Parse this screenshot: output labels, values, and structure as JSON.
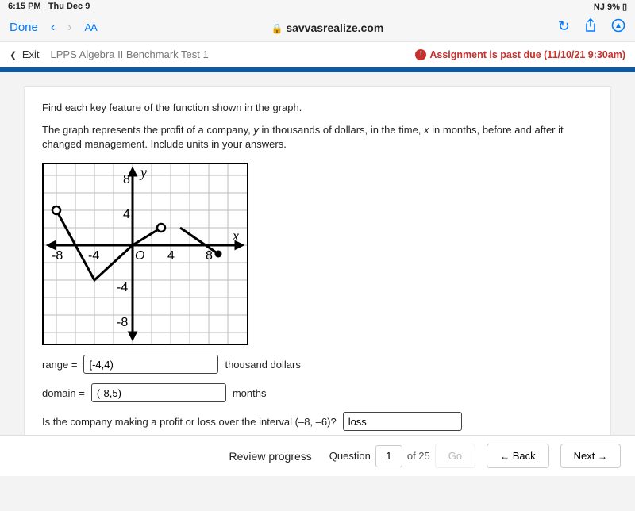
{
  "status": {
    "time": "6:15 PM",
    "date": "Thu Dec 9",
    "battery": "9%"
  },
  "browser": {
    "done": "Done",
    "aa": "AA",
    "url": "savvasrealize.com"
  },
  "header": {
    "exit": "Exit",
    "title": "LPPS Algebra II Benchmark Test 1",
    "past_due": "Assignment is past due (11/10/21 9:30am)"
  },
  "question": {
    "line1": "Find each key feature of the function shown in the graph.",
    "line2a": "The graph represents the profit of a company, ",
    "line2b": " in thousands of dollars, in the time, ",
    "line2c": " in months, before and after it changed management. Include units in your answers.",
    "var_y": "y",
    "var_x": "x",
    "range_label": "range =",
    "range_value": "[-4,4)",
    "range_unit": "thousand dollars",
    "domain_label": "domain =",
    "domain_value": "(-8,5)",
    "domain_unit": "months",
    "interval_q": "Is the company making a profit or loss over the interval (–8, –6)?",
    "interval_value": "loss"
  },
  "chart_data": {
    "type": "line",
    "xlabel": "x",
    "ylabel": "y",
    "xticks": [
      -8,
      -4,
      4,
      8
    ],
    "yticks": [
      -8,
      -4,
      4,
      8
    ],
    "xlim": [
      -10,
      10
    ],
    "ylim": [
      -10,
      10
    ],
    "series": [
      {
        "name": "profit",
        "points": [
          [
            -8,
            4
          ],
          [
            -4,
            -4
          ],
          [
            0,
            0
          ],
          [
            3,
            2
          ],
          [
            5,
            2
          ],
          [
            9,
            -1
          ]
        ],
        "open_endpoints": [
          [
            -8,
            4
          ],
          [
            3,
            2
          ]
        ],
        "closed_endpoints": [
          [
            9,
            -1
          ]
        ]
      }
    ]
  },
  "footer": {
    "review": "Review progress",
    "question_label": "Question",
    "question_num": "1",
    "of_total": "of 25",
    "go": "Go",
    "back": "Back",
    "next": "Next"
  }
}
